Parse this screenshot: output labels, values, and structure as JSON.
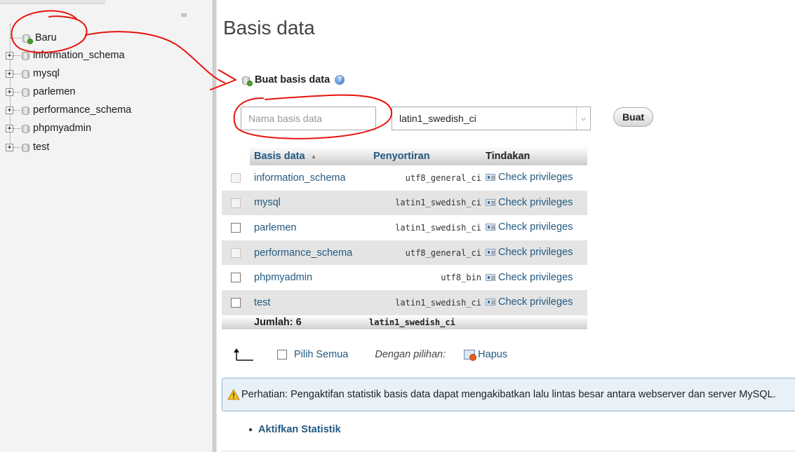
{
  "sidebar": {
    "items": [
      {
        "label": "Baru",
        "type": "new"
      },
      {
        "label": "information_schema",
        "type": "db"
      },
      {
        "label": "mysql",
        "type": "db"
      },
      {
        "label": "parlemen",
        "type": "db"
      },
      {
        "label": "performance_schema",
        "type": "db"
      },
      {
        "label": "phpmyadmin",
        "type": "db"
      },
      {
        "label": "test",
        "type": "db"
      }
    ],
    "expander_symbol": "+"
  },
  "main": {
    "title": "Basis data",
    "create": {
      "header": "Buat basis data",
      "name_placeholder": "Nama basis data",
      "collation_value": "latin1_swedish_ci",
      "button_label": "Buat"
    },
    "table": {
      "headers": {
        "name": "Basis data",
        "collation": "Penyortiran",
        "actions": "Tindakan"
      },
      "rows": [
        {
          "name": "information_schema",
          "collation": "utf8_general_ci",
          "action": "Check privileges",
          "checkbox_enabled": false
        },
        {
          "name": "mysql",
          "collation": "latin1_swedish_ci",
          "action": "Check privileges",
          "checkbox_enabled": false
        },
        {
          "name": "parlemen",
          "collation": "latin1_swedish_ci",
          "action": "Check privileges",
          "checkbox_enabled": true
        },
        {
          "name": "performance_schema",
          "collation": "utf8_general_ci",
          "action": "Check privileges",
          "checkbox_enabled": false
        },
        {
          "name": "phpmyadmin",
          "collation": "utf8_bin",
          "action": "Check privileges",
          "checkbox_enabled": true
        },
        {
          "name": "test",
          "collation": "latin1_swedish_ci",
          "action": "Check privileges",
          "checkbox_enabled": true
        }
      ],
      "total_label": "Jumlah: 6",
      "total_collation": "latin1_swedish_ci"
    },
    "bulk": {
      "select_all": "Pilih Semua",
      "with_selected": "Dengan pilihan:",
      "delete": "Hapus"
    },
    "notice": "Perhatian: Pengaktifan statistik basis data dapat mengakibatkan lalu lintas besar antara webserver dan server MySQL.",
    "enable_stats": "Aktifkan Statistik"
  },
  "colors": {
    "link": "#235a81",
    "annotation": "#e8140c",
    "notice_bg": "#e8f0f8",
    "row_alt": "#e4e4e4"
  }
}
